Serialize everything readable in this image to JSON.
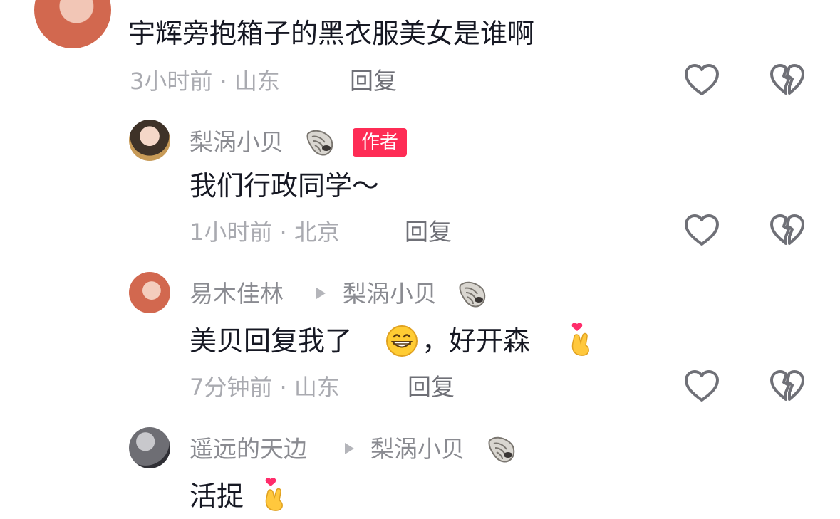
{
  "comments": [
    {
      "text": "宇辉旁抱箱子的黑衣服美女是谁啊",
      "meta": "3小时前 · 山东",
      "reply": "回复"
    },
    {
      "author": "梨涡小贝",
      "badge": "作者",
      "text": "我们行政同学～",
      "meta": "1小时前 · 北京",
      "reply": "回复"
    },
    {
      "author": "易木佳林",
      "reply_to": "梨涡小贝",
      "text_a": "美贝回复我了",
      "text_b": "，好开森",
      "meta": "7分钟前 · 山东",
      "reply": "回复"
    },
    {
      "author": "遥远的天边",
      "reply_to": "梨涡小贝",
      "text": "活捉"
    }
  ],
  "icons": {
    "like": "heart-outline-icon",
    "dislike": "broken-heart-icon",
    "shell": "shell-emoji",
    "grin": "grinning-face-emoji",
    "finger_heart": "finger-heart-emoji"
  },
  "colors": {
    "badge_bg": "#fe2c55",
    "primary_text": "#161823",
    "secondary_text": "#8a8b91"
  }
}
